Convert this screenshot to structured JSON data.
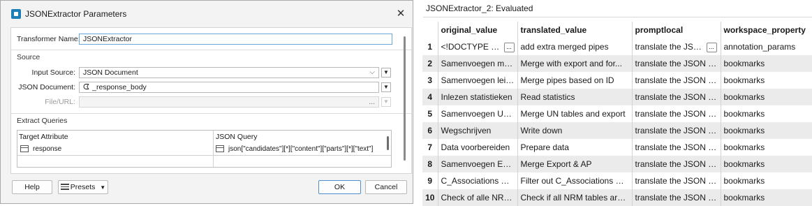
{
  "dialog": {
    "title": "JSONExtractor Parameters",
    "transformer_name_label": "Transformer Name:",
    "transformer_name_value": "JSONExtractor",
    "source_section": "Source",
    "input_source_label": "Input Source:",
    "input_source_value": "JSON Document",
    "json_document_label": "JSON Document:",
    "json_document_value": "_response_body",
    "file_url_label": "File/URL:",
    "ellipsis": "...",
    "extract_section": "Extract Queries",
    "grid_headers": [
      "Target Attribute",
      "JSON Query"
    ],
    "grid_row": {
      "target": "response",
      "query": "json[\"candidates\"][*][\"content\"][\"parts\"][*][\"text\"]"
    },
    "help_label": "Help",
    "presets_label": "Presets",
    "ok_label": "OK",
    "cancel_label": "Cancel"
  },
  "table_view": {
    "title": "JSONExtractor_2: Evaluated",
    "columns": [
      "original_value",
      "translated_value",
      "promptlocal",
      "workspace_property"
    ],
    "rows": [
      {
        "n": "1",
        "original_value": "<!DOCTYPE HTM",
        "translated_value": "add extra merged pipes",
        "promptlocal": "translate the JSON i",
        "workspace_property": "annotation_params"
      },
      {
        "n": "2",
        "original_value": "Samenvoegen me...",
        "translated_value": "Merge with export and for...",
        "promptlocal": "translate the JSON in...",
        "workspace_property": "bookmarks"
      },
      {
        "n": "3",
        "original_value": "Samenvoegen leid...",
        "translated_value": "Merge pipes based on ID",
        "promptlocal": "translate the JSON in...",
        "workspace_property": "bookmarks"
      },
      {
        "n": "4",
        "original_value": "Inlezen statistieken",
        "translated_value": "Read statistics",
        "promptlocal": "translate the JSON in...",
        "workspace_property": "bookmarks"
      },
      {
        "n": "5",
        "original_value": "Samenvoegen UN...",
        "translated_value": "Merge UN tables and export",
        "promptlocal": "translate the JSON in...",
        "workspace_property": "bookmarks"
      },
      {
        "n": "6",
        "original_value": "Wegschrijven",
        "translated_value": "Write down",
        "promptlocal": "translate the JSON in...",
        "workspace_property": "bookmarks"
      },
      {
        "n": "7",
        "original_value": "Data voorbereiden",
        "translated_value": "Prepare data",
        "promptlocal": "translate the JSON in...",
        "workspace_property": "bookmarks"
      },
      {
        "n": "8",
        "original_value": "Samenvoegen Exp...",
        "translated_value": "Merge Export & AP",
        "promptlocal": "translate the JSON in...",
        "workspace_property": "bookmarks"
      },
      {
        "n": "9",
        "original_value": "C_Associations & ...",
        "translated_value": "Filter out C_Associations & ...",
        "promptlocal": "translate the JSON in...",
        "workspace_property": "bookmarks"
      },
      {
        "n": "10",
        "original_value": "Check of alle NRM...",
        "translated_value": "Check if all NRM tables are i...",
        "promptlocal": "translate the JSON in...",
        "workspace_property": "bookmarks"
      }
    ],
    "truncate_button_label": "..."
  }
}
